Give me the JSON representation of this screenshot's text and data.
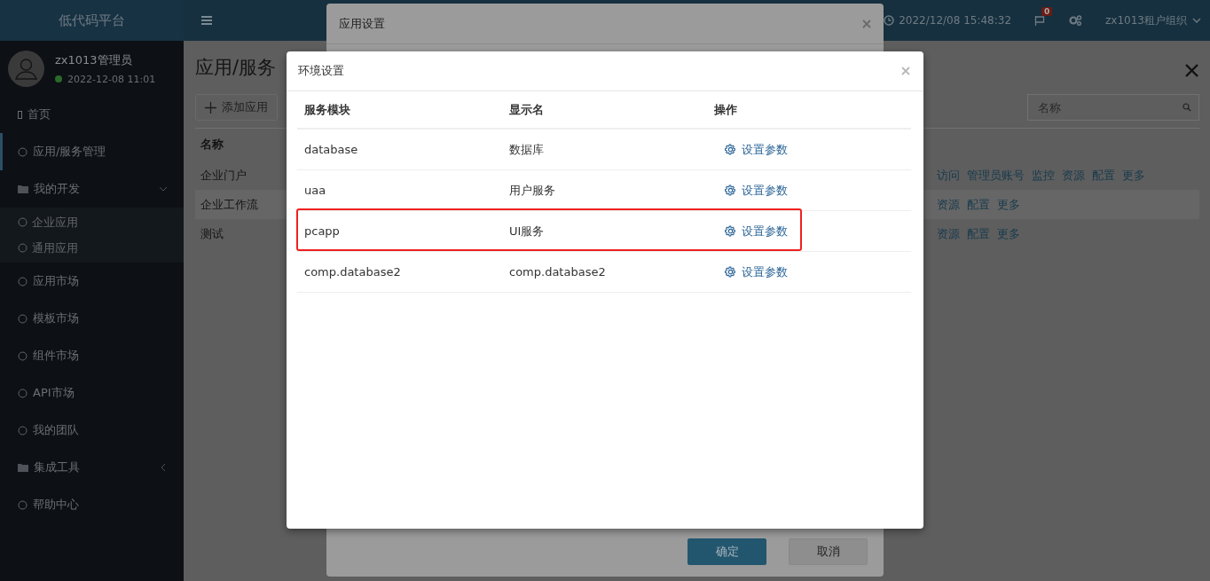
{
  "sidebar": {
    "brand": "低代码平台",
    "user": {
      "name": "zx1013管理员",
      "status_time": "2022-12-08 11:01",
      "online": true
    },
    "items": [
      {
        "kind": "page",
        "label": "首页",
        "selected": false
      },
      {
        "kind": "link",
        "label": "应用/服务管理",
        "selected": true
      },
      {
        "kind": "folder",
        "label": "我的开发",
        "selected": false,
        "expanded": true,
        "children": [
          {
            "label": "企业应用",
            "selected": false
          },
          {
            "label": "通用应用",
            "selected": false
          }
        ]
      },
      {
        "kind": "link",
        "label": "应用市场",
        "selected": false
      },
      {
        "kind": "link",
        "label": "模板市场",
        "selected": false
      },
      {
        "kind": "link",
        "label": "组件市场",
        "selected": false
      },
      {
        "kind": "link",
        "label": "API市场",
        "selected": false
      },
      {
        "kind": "link",
        "label": "我的团队",
        "selected": false
      },
      {
        "kind": "folder",
        "label": "集成工具",
        "selected": false,
        "expanded": false
      },
      {
        "kind": "link",
        "label": "帮助中心",
        "selected": false
      }
    ]
  },
  "topbar": {
    "datetime": "2022/12/08 15:48:32",
    "notification_count": "0",
    "organization": "zx1013租户组织"
  },
  "page": {
    "title": "应用/服务",
    "add_button": "添加应用",
    "search": {
      "placeholder": "名称"
    },
    "column": "名称",
    "rows": [
      {
        "name": "企业门户",
        "actions": [
          "访问",
          "管理员账号",
          "监控",
          "资源",
          "配置",
          "更多"
        ]
      },
      {
        "name": "企业工作流",
        "actions": [
          "资源",
          "配置",
          "更多"
        ]
      },
      {
        "name": "测试",
        "actions": [
          "资源",
          "配置",
          "更多"
        ]
      }
    ]
  },
  "back_dialog": {
    "title": "应用设置",
    "buttons": [
      {
        "label": "确定",
        "primary": true
      },
      {
        "label": "取消",
        "primary": false
      }
    ]
  },
  "dialog": {
    "title": "环境设置",
    "columns": [
      "服务模块",
      "显示名",
      "操作"
    ],
    "rows": [
      {
        "module": "database",
        "display_name": "数据库",
        "action": "设置参数",
        "highlighted": false
      },
      {
        "module": "uaa",
        "display_name": "用户服务",
        "action": "设置参数",
        "highlighted": false
      },
      {
        "module": "pcapp",
        "display_name": "UI服务",
        "action": "设置参数",
        "highlighted": true
      },
      {
        "module": "comp.database2",
        "display_name": "comp.database2",
        "action": "设置参数",
        "highlighted": false
      }
    ]
  }
}
